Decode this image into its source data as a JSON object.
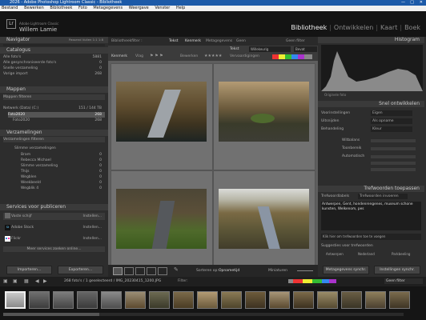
{
  "window": {
    "title": "2026 - Adobe Photoshop Lightroom Classic - Bibliotheek"
  },
  "menu": [
    "Bestand",
    "Bewerken",
    "Bibliotheek",
    "Foto",
    "Metagegevens",
    "Weergave",
    "Venster",
    "Help"
  ],
  "identity": {
    "line1": "Adobe Lightroom Classic",
    "line2": "Willem Lamie"
  },
  "modules": [
    "Bibliotheek",
    "Ontwikkelen",
    "Kaart",
    "Boek"
  ],
  "left": {
    "navigator": {
      "title": "Navigator",
      "zoom": "Passend  Vullen  1:1  1:8"
    },
    "catalog": {
      "title": "Catalogus",
      "items": [
        {
          "label": "Alle foto's",
          "count": "5881"
        },
        {
          "label": "Alle gesynchroniseerde foto's",
          "count": "0"
        },
        {
          "label": "Snelle verzameling",
          "count": "0"
        },
        {
          "label": "Vorige import",
          "count": "268"
        }
      ]
    },
    "folders": {
      "title": "Mappen",
      "filter": "Mappen filteren",
      "volume": "Netwerk (Data) (C:)",
      "volume_info": "151 / 144 TB",
      "items": [
        {
          "label": "Foto2020",
          "count": "268"
        },
        {
          "label": "Foto2020",
          "count": "268"
        }
      ]
    },
    "collections": {
      "title": "Verzamelingen",
      "filter": "Verzamelingen filteren",
      "items": [
        {
          "label": "Slimme verzamelingen",
          "count": ""
        },
        {
          "label": "Bram",
          "count": "0"
        },
        {
          "label": "Rebecca Michael",
          "count": "0"
        },
        {
          "label": "Slimme verzameling",
          "count": "0"
        },
        {
          "label": "Thijs",
          "count": "0"
        },
        {
          "label": "Wegblen",
          "count": "0"
        },
        {
          "label": "Weekbeeld",
          "count": "0"
        },
        {
          "label": "Wegblik 4",
          "count": "0"
        }
      ]
    },
    "publish": {
      "title": "Services voor publiceren",
      "items": [
        {
          "label": "Vaste schijf",
          "action": "Instellen..."
        },
        {
          "label": "Adobe Stock",
          "action": "Instellen..."
        },
        {
          "label": "Flickr",
          "action": "Instellen..."
        }
      ],
      "more": "Meer services zoeken online..."
    },
    "import_btn": "Importeren...",
    "export_btn": "Exporteren..."
  },
  "center": {
    "library_filter": "Bibliotheekfilter :",
    "filter_tabs": [
      "Tekst",
      "Kenmerk",
      "Metagegevens",
      "Geen"
    ],
    "filter_right": "Geen filter",
    "bar": {
      "text": "Tekst",
      "field": "Willekeurig doorzoekbaar",
      "cond": "Bevat"
    },
    "toolbar_left": [
      "Kenmerk",
      "Vlag"
    ],
    "toolbar_mid": [
      "Bewerken",
      "Vervaardigingen"
    ],
    "toolbar_sort_label": "Sorteren op:",
    "toolbar_sort_value": "Opnametijd",
    "toolbar_thumbs": "Miniaturen"
  },
  "right": {
    "histogram": {
      "title": "Histogram",
      "info": "Originele foto"
    },
    "quick": {
      "title": "Snel ontwikkelen",
      "rows": [
        {
          "label": "Voorinstellingen",
          "value": "Eigen"
        },
        {
          "label": "Uitsnijden",
          "value": "Als opname"
        },
        {
          "label": "Behandeling",
          "value": "Kleur"
        }
      ],
      "sub": [
        "Witbalans",
        "Toonbereik",
        "Automatisch"
      ]
    },
    "keywords": {
      "title": "Trefwoorden toepassen",
      "label": "Trefwoordlabels",
      "value": "Trefwoorden invoeren",
      "text": "Antwerpen, Gent, hondenrengenes, museum schone kunsten, Welkenom, pes",
      "add": "Klik hier om trefwoorden toe te voegen",
      "suggested": "Suggesties voor trefwoorden",
      "chips": [
        "Antwerpen",
        "Nederland",
        "Parkbeeling"
      ]
    },
    "sync_btn": "Metagegevens synchr.",
    "sync2_btn": "Instellingen synchr."
  },
  "strip": {
    "info": "268 foto's / 1 geselecteerd / IMG_20230415_1200.JPG",
    "filter": "Filter:",
    "filter_value": "Geen filter"
  },
  "thumbs_count": 17
}
